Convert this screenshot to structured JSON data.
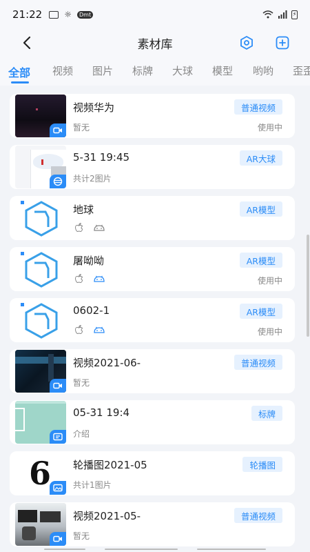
{
  "statusbar": {
    "time": "21:22",
    "sim_label": "Dmt",
    "battery": "⚡"
  },
  "header": {
    "title": "素材库"
  },
  "tabs": [
    "全部",
    "视频",
    "图片",
    "标牌",
    "大球",
    "模型",
    "哟哟",
    "歪歪"
  ],
  "active_tab": 0,
  "items": [
    {
      "name": "视频华为",
      "sub": "暂无",
      "tag": "普通视频",
      "status": "使用中",
      "thumb": "video-dark",
      "badge": "video-icon"
    },
    {
      "name": "5-31 19:45",
      "sub": "共计2图片",
      "tag": "AR大球",
      "status": "",
      "thumb": "sphere-screen",
      "badge": "globe-icon"
    },
    {
      "name": "地球",
      "sub": "",
      "tag": "AR模型",
      "status": "",
      "thumb": "cube",
      "badge": "",
      "os": true
    },
    {
      "name": "屠呦呦",
      "sub": "",
      "tag": "AR模型",
      "status": "使用中",
      "thumb": "cube",
      "badge": "",
      "os": true
    },
    {
      "name": "0602-1",
      "sub": "",
      "tag": "AR模型",
      "status": "使用中",
      "thumb": "cube",
      "badge": "",
      "os": true
    },
    {
      "name": "视频2021-06-",
      "sub": "暂无",
      "tag": "普通视频",
      "status": "",
      "thumb": "video-blue",
      "badge": "video-icon"
    },
    {
      "name": "05-31 19:4",
      "sub": "介绍",
      "tag": "标牌",
      "status": "",
      "thumb": "sign-green",
      "badge": "sign-icon"
    },
    {
      "name": "轮播图2021-05",
      "sub": "共计1图片",
      "tag": "轮播图",
      "status": "",
      "thumb": "number-six",
      "badge": "image-icon",
      "six": "6"
    },
    {
      "name": "视频2021-05-",
      "sub": "暂无",
      "tag": "普通视频",
      "status": "",
      "thumb": "video-office",
      "badge": "video-icon"
    }
  ],
  "colors": {
    "accent": "#2b8cf7",
    "tag_bg": "#e6f1fe",
    "background": "#f2f4f8"
  }
}
